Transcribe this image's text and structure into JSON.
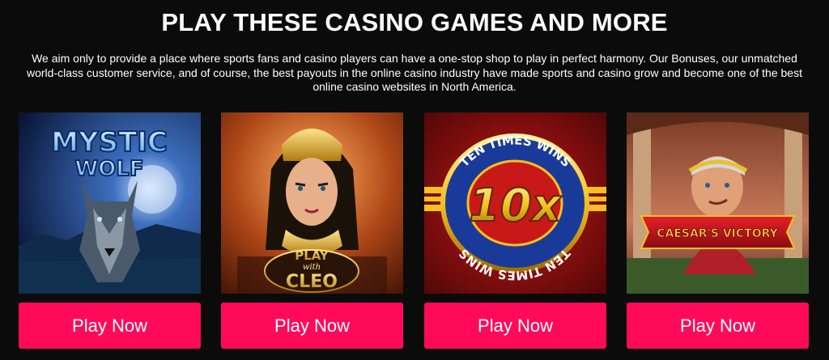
{
  "section": {
    "title": "PLAY THESE CASINO GAMES AND MORE",
    "intro": "We aim only to provide a place where sports fans and casino players can have a one-stop shop to play in perfect harmony. Our Bonuses, our unmatched world-class customer service, and of course, the best payouts in the online casino industry have made sports and casino grow and become one of the best online casino websites in North America."
  },
  "games": [
    {
      "logo_line1": "MYSTIC",
      "logo_line2": "WOLF",
      "button_label": "Play Now"
    },
    {
      "logo_line1": "PLAY",
      "logo_line2": "with",
      "logo_line3": "CLEO",
      "button_label": "Play Now"
    },
    {
      "logo_center": "10x",
      "logo_ring_top": "TEN TIMES WINS",
      "logo_ring_bottom": "TEN TIMES WINS",
      "button_label": "Play Now"
    },
    {
      "logo_banner": "CAESAR'S VICTORY",
      "button_label": "Play Now"
    }
  ],
  "colors": {
    "button": "#ff0a5a",
    "background": "#0b0b0b",
    "text": "#ffffff"
  }
}
